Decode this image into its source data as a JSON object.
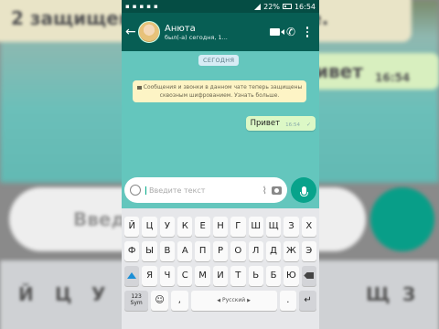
{
  "background": {
    "top_text": "2 защищены с ... ать больше.",
    "bg_msg": "ивет",
    "bg_time": "16:54",
    "bg_input_text": "Введ",
    "bg_keys": [
      "Й",
      "Ц",
      "У",
      "Щ",
      "З"
    ]
  },
  "status_bar": {
    "battery": "22%",
    "time": "16:54"
  },
  "toolbar": {
    "contact_name": "Анюта",
    "contact_status": "был(-а) сегодня, 1..."
  },
  "chat": {
    "date_chip": "СЕГОДНЯ",
    "encryption_notice": "Сообщения и звонки в данном чате теперь защищены сквозным шифрованием. Узнать больше.",
    "messages": [
      {
        "text": "Привет",
        "time": "16:54"
      }
    ]
  },
  "input": {
    "placeholder": "Введите текст"
  },
  "keyboard": {
    "row1": [
      "Й",
      "Ц",
      "У",
      "К",
      "Е",
      "Н",
      "Г",
      "Ш",
      "Щ",
      "З",
      "Х"
    ],
    "row2": [
      "Ф",
      "Ы",
      "В",
      "А",
      "П",
      "Р",
      "О",
      "Л",
      "Д",
      "Ж",
      "Э"
    ],
    "row3": [
      "Я",
      "Ч",
      "С",
      "М",
      "И",
      "Т",
      "Ь",
      "Б",
      "Ю"
    ],
    "symbols_label": "123\nSym",
    "space_label": "Русский",
    "comma": ",",
    "period": ".",
    "emoji_key": "☺"
  },
  "colors": {
    "header": "#075e54",
    "chat_bg": "#64c6bd",
    "outgoing_bubble": "#dcf8c6",
    "accent": "#08a38b"
  }
}
